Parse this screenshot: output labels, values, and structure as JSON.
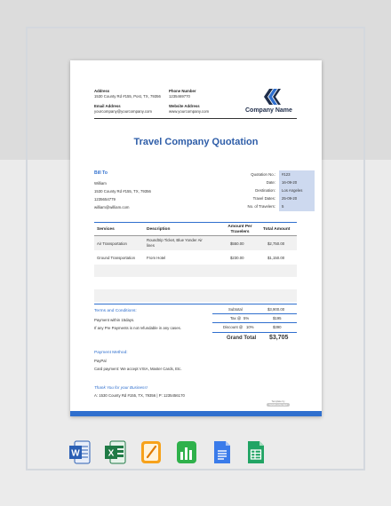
{
  "document": {
    "title": "Travel Company Quotation",
    "company_name": "Company Name",
    "header": {
      "address_label": "Address",
      "address_value": "1530 County Rd #155, Post, TX, 79356",
      "phone_label": "Phone Number",
      "phone_value": "1235469770",
      "email_label": "Email Address",
      "email_value": "yourcompany@yourcompany.com",
      "website_label": "Website Address",
      "website_value": "www.yourcompany.com"
    },
    "bill_to": {
      "label": "Bill To",
      "name": "William",
      "address": "1530 County Rd #155, TX, 79356",
      "phone": "1235654779",
      "email": "william@william.com"
    },
    "quotation_info": [
      {
        "label": "Quotation No.:",
        "value": "#123"
      },
      {
        "label": "Date:",
        "value": "16-09-20"
      },
      {
        "label": "Destination:",
        "value": "Los Angeles"
      },
      {
        "label": "Travel Dates:",
        "value": "25-09-20"
      },
      {
        "label": "No. of Travelers:",
        "value": "5"
      }
    ],
    "table": {
      "headers": [
        "Services",
        "Description",
        "Amount Per Travelers",
        "Total Amount"
      ],
      "rows": [
        [
          "Air Transportation",
          "Roundtrip Ticket, Blue Yonder Air lines",
          "$550.00",
          "$2,750.00"
        ],
        [
          "Ground Transportation",
          "From Hotel",
          "$230.00",
          "$1,150.00"
        ]
      ]
    },
    "terms": {
      "label": "Terms and Conditions:",
      "line1": "Payment within 15days.",
      "line2": "If any Pre Payments is not refundable in any cases."
    },
    "summary": {
      "subtotal_label": "Subtotal",
      "subtotal_value": "$3,900.00",
      "tax_label": "Tax @",
      "tax_rate": "5%",
      "tax_value": "$195",
      "discount_label": "Discount @",
      "discount_rate": "10%",
      "discount_value": "$390",
      "grand_total_label": "Grand Total",
      "grand_total_value": "$3,705"
    },
    "payment": {
      "label": "Payment Method:",
      "line1": "PayPal",
      "line2": "Card payment: We accept VISA, Master Cards, Etc."
    },
    "thanks": "Thank You for your Business!",
    "footer_line": "A: 1530 County Rd #155, TX, 79356 | P: 1235456170",
    "badge_top": "Template by",
    "badge_brand": "TEMPLATE.NET"
  },
  "file_formats": [
    "word-icon",
    "excel-icon",
    "pages-icon",
    "numbers-icon",
    "google-docs-icon",
    "google-sheets-icon"
  ],
  "colors": {
    "accent": "#2f6fce",
    "title": "#2e5da8",
    "quote_box": "#cdd9ef"
  }
}
